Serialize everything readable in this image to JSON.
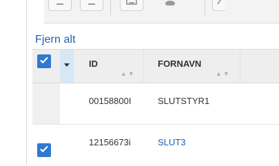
{
  "actions": {
    "clear_all": "Fjern alt"
  },
  "table": {
    "columns": [
      {
        "label": "ID",
        "sort": "▲▼"
      },
      {
        "label": "FORNAVN",
        "sort": "▲▼"
      }
    ],
    "rows": [
      {
        "id": "00158800I",
        "first_name": "SLUTSTYR1",
        "selected": false
      },
      {
        "id": "12156673i",
        "first_name": "SLUT3",
        "selected": true
      }
    ]
  },
  "colors": {
    "accent": "#2f7ad0",
    "link": "#1e5fb5",
    "header_bg": "#eeeeee"
  }
}
